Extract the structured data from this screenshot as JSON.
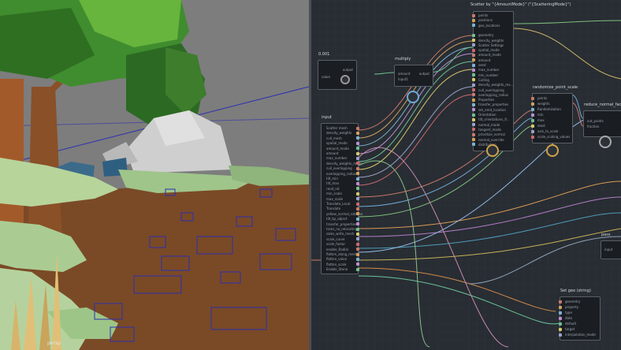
{
  "viewport": {
    "camera_label": "persp"
  },
  "graph": {
    "nodes": {
      "scatter": {
        "title": "Scatter by \"{AmountMode}\" (\"{ScatteringMode}\")",
        "rows": [
          "points",
          "positions",
          "geo_locations",
          "",
          "geometry",
          "density_weights",
          "Scatter Settings",
          "spatial_mode",
          "amount_mode",
          "amount",
          "seed",
          "max_number",
          "min_number",
          "Culling",
          "density_weights_mo...",
          "cull_overlapping",
          "overlapping_radius",
          "Properties",
          "transfer_properties",
          "set_emit_location",
          "Orientation",
          "tilt_orientations_fr...",
          "normal_mode",
          "tangent_mode",
          "prioritize_normal",
          "normal_override",
          "distribution"
        ]
      },
      "value": {
        "title": "0.001",
        "row": "value",
        "out": "output"
      },
      "multiply": {
        "title": "multiply",
        "rows": [
          "amount",
          "input1"
        ],
        "out": "output"
      },
      "input": {
        "title": "input",
        "rows": [
          "Scatter mesh",
          "density_weights",
          "cull_mesh",
          "spatial_mode",
          "amount_mode",
          "amount",
          "max_number",
          "density_weights_mode",
          "cull_overlapping",
          "overlapping_radius",
          "tilt_min",
          "tilt_max",
          "rand_rot",
          "min_scale",
          "max_scale",
          "Translate_Local",
          "Translate",
          "yellow_normal_rotation",
          "tilt_by_object",
          "transfer_properties",
          "trans_no_relocating",
          "sales_write_mesh",
          "scale_curve",
          "scale_factor",
          "enable_Radial",
          "flatten_along_mesh",
          "flatten_value",
          "flatten_scale",
          "Enable_Stone"
        ]
      },
      "randomize": {
        "title": "randomize_point_scale",
        "rows": [
          "points",
          "weights",
          "Randomization",
          "min",
          "max",
          "seed",
          "axis_to_scale",
          "scale_scaling_values"
        ],
        "out": [
          "out_points",
          "point_scale"
        ]
      },
      "reduce": {
        "title": "reduce_normal_facing",
        "rows": [
          "out_points",
          "fraction"
        ],
        "out": [
          "out_geometry"
        ]
      },
      "pass": {
        "title": "pass",
        "rows": [
          "input"
        ]
      },
      "setgeo": {
        "title": "Set geo (string)",
        "rows": [
          "geometry",
          "property",
          "type",
          "data",
          "default",
          "target",
          "interpolation_mode"
        ]
      }
    }
  },
  "colors": {
    "accent": "#cfa24a",
    "node_bg": "#1a1e23",
    "graph_bg": "#282d33",
    "ground": "#7a4a26",
    "sky": "#7d7d7d"
  }
}
